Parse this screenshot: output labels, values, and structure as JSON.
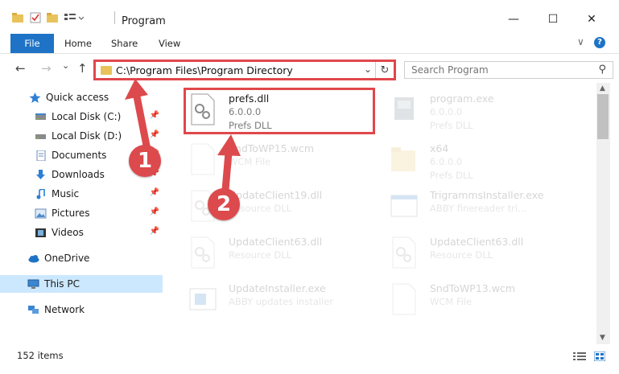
{
  "window": {
    "title": "Program",
    "minimize_glyph": "—",
    "maximize_glyph": "☐",
    "close_glyph": "✕",
    "collapse_glyph": "∨",
    "help_glyph": "?"
  },
  "ribbon": {
    "tabs": [
      {
        "label": "File"
      },
      {
        "label": "Home"
      },
      {
        "label": "Share"
      },
      {
        "label": "View"
      }
    ]
  },
  "navigation": {
    "back_glyph": "←",
    "forward_glyph": "→",
    "recent_glyph": "⌄",
    "up_glyph": "↑",
    "address": "C:\\Program Files\\Program Directory",
    "address_dropdown_glyph": "⌄",
    "refresh_glyph": "↻",
    "search_placeholder": "Search Program",
    "search_glyph": "⚲"
  },
  "sidebar": {
    "items": [
      {
        "label": "Quick access",
        "icon": "star-icon",
        "pinned": false
      },
      {
        "label": "Local Disk (C:)",
        "icon": "drive-icon",
        "pinned": true
      },
      {
        "label": "Local Disk (D:)",
        "icon": "drive-icon",
        "pinned": true
      },
      {
        "label": "Documents",
        "icon": "documents-icon",
        "pinned": true
      },
      {
        "label": "Downloads",
        "icon": "download-icon",
        "pinned": true
      },
      {
        "label": "Music",
        "icon": "music-icon",
        "pinned": true
      },
      {
        "label": "Pictures",
        "icon": "pictures-icon",
        "pinned": true
      },
      {
        "label": "Videos",
        "icon": "videos-icon",
        "pinned": true
      },
      {
        "label": "OneDrive",
        "icon": "cloud-icon",
        "pinned": false
      },
      {
        "label": "This PC",
        "icon": "pc-icon",
        "pinned": false,
        "selected": true
      },
      {
        "label": "Network",
        "icon": "network-icon",
        "pinned": false
      }
    ],
    "pin_glyph": "📌"
  },
  "files": [
    {
      "name": "prefs.dll",
      "line2": "6.0.0.0",
      "line3": "Prefs DLL",
      "icon": "dll-gear-icon",
      "highlighted": true
    },
    {
      "name": "program.exe",
      "line2": "6.0.0.0",
      "line3": "Prefs DLL",
      "icon": "exe-icon"
    },
    {
      "name": "SndToWP15.wcm",
      "line2": "WCM File",
      "line3": "",
      "icon": "blank-file-icon"
    },
    {
      "name": "x64",
      "line2": "6.0.0.0",
      "line3": "Prefs DLL",
      "icon": "folder-icon"
    },
    {
      "name": "UpdateClient19.dll",
      "line2": "Resource DLL",
      "line3": "",
      "icon": "dll-gear-icon"
    },
    {
      "name": "TrigrammsInstaller.exe",
      "line2": "ABBY finereader tri...",
      "line3": "",
      "icon": "exe-window-icon"
    },
    {
      "name": "UpdateClient63.dll",
      "line2": "Resource DLL",
      "line3": "",
      "icon": "dll-gear-icon"
    },
    {
      "name": "UpdateClient63.dll",
      "line2": "Resource DLL",
      "line3": "",
      "icon": "dll-gear-icon"
    },
    {
      "name": "UpdateInstaller.exe",
      "line2": "ABBY updates installer",
      "line3": "",
      "icon": "exe-window-icon"
    },
    {
      "name": "SndToWP13.wcm",
      "line2": "WCM File",
      "line3": "",
      "icon": "blank-file-icon"
    }
  ],
  "status": {
    "item_count": "152 items"
  },
  "annotations": {
    "step1": "1",
    "step2": "2"
  },
  "colors": {
    "accent": "#1e73c6",
    "highlight": "#e0474c",
    "selected": "#cce8ff"
  }
}
